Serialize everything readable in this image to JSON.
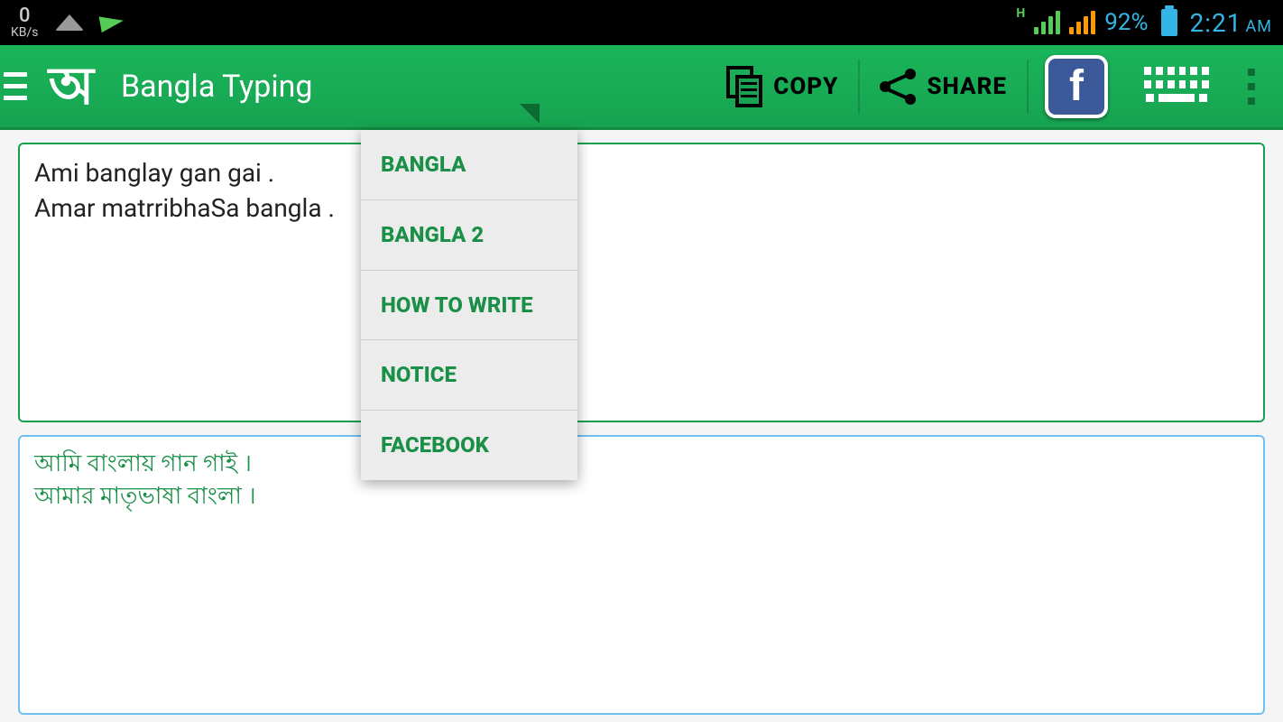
{
  "status": {
    "net_speed_value": "0",
    "net_speed_unit": "KB/s",
    "battery_pct": "92%",
    "time": "2:21",
    "ampm": "AM",
    "h_label": "H"
  },
  "toolbar": {
    "app_title": "Bangla Typing",
    "logo_glyph": "অ",
    "copy_label": "COPY",
    "share_label": "SHARE",
    "fb_glyph": "f"
  },
  "dropdown": {
    "items": [
      "BANGLA",
      "BANGLA 2",
      "HOW TO WRITE",
      "NOTICE",
      "FACEBOOK"
    ]
  },
  "editor": {
    "input_text": "Ami banglay gan gai  .\nAmar matrribhaSa bangla .",
    "output_text": "আমি বাংলায় গান গাই  ।\nআমার মাতৃভাষা বাংলা ।"
  }
}
